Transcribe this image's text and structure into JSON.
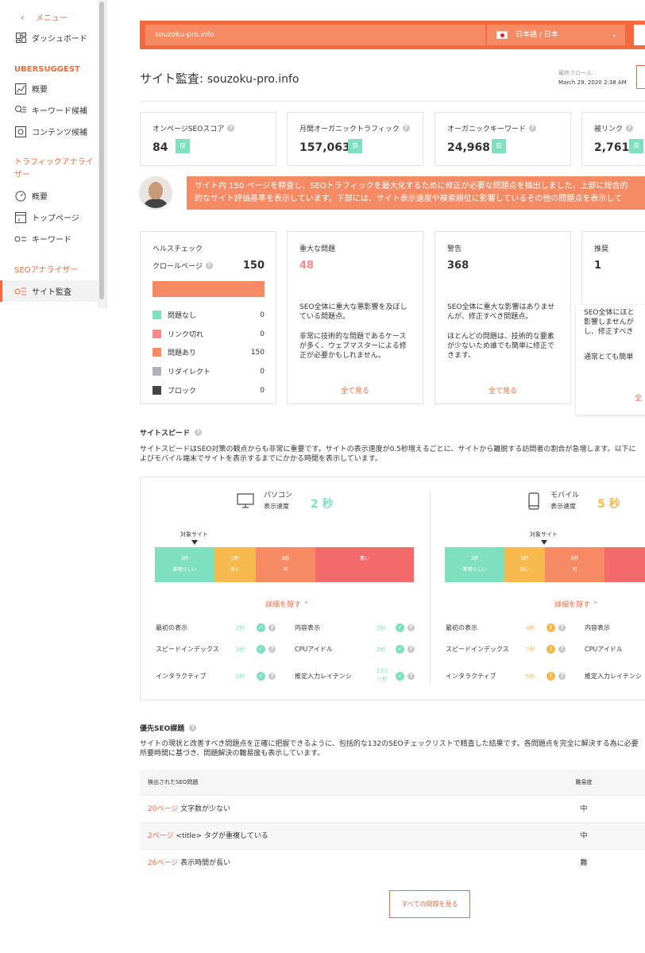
{
  "sidebar": {
    "back_label": "メニュー",
    "dashboard": "ダッシュボード",
    "section_ubersuggest": "UBERSUGGEST",
    "overview": "概要",
    "keyword_ideas": "キーワード候補",
    "content_ideas": "コンテンツ候補",
    "section_traffic": "トラフィックアナライザー",
    "traffic_overview": "概要",
    "top_pages": "トップページ",
    "keywords": "キーワード",
    "section_seo": "SEOアナライザー",
    "site_audit": "サイト監査"
  },
  "header": {
    "domain_value": "souzoku-pro.info",
    "language": "日本語 / 日本"
  },
  "page": {
    "title_prefix": "サイト監査:",
    "title_domain": "souzoku-pro.info",
    "last_crawl_label": "最終クロール:",
    "last_crawl_date": "March 29, 2020 2:38 AM"
  },
  "metrics": [
    {
      "label": "オンページSEOスコア",
      "value": "84",
      "badge": "良"
    },
    {
      "label": "月間オーガニックトラフィック",
      "value": "157,063",
      "badge": "良"
    },
    {
      "label": "オーガニックキーワード",
      "value": "24,968",
      "badge": "良"
    },
    {
      "label": "被リンク",
      "value": "2,761",
      "badge": "良"
    }
  ],
  "banner": {
    "line1": "サイト内 150 ページを精査し、SEOトラフィックを最大化するために修正が必要な問題点を抽出しました。上部に総合的",
    "line2": "的なサイト評価基準を表示しています。下部には、サイト表示速度や検索順位に影響しているその他の問題点を表示して"
  },
  "health": {
    "title": "ヘルスチェック",
    "crawl_label": "クロールページ",
    "crawl_value": "150",
    "legend": [
      {
        "label": "問題なし",
        "value": "0",
        "color": "#7ee0bf"
      },
      {
        "label": "リンク切れ",
        "value": "0",
        "color": "#f8888a"
      },
      {
        "label": "問題あり",
        "value": "150",
        "color": "#f58a64"
      },
      {
        "label": "リダイレクト",
        "value": "0",
        "color": "#b0b0b8"
      },
      {
        "label": "ブロック",
        "value": "0",
        "color": "#444444"
      }
    ]
  },
  "issues": [
    {
      "title": "重大な問題",
      "value": "48",
      "color": "#f8888a",
      "desc1": "SEO全体に重大な悪影響を及ぼし\nている問題点。",
      "desc2": "非常に技術的な問題であるケース\nが多く、ウェブマスターによる修\n正が必要かもしれません。",
      "see_all": "全て見る"
    },
    {
      "title": "警告",
      "value": "368",
      "color": "#333333",
      "desc1": "SEO全体に重大な影響はありませ\nんが、修正すべき問題点。",
      "desc2": "ほとんどの問題は、技術的な要素\nが少ないため誰でも簡単に修正で\nきます。",
      "see_all": "全て見る"
    },
    {
      "title": "推奨",
      "value": "1",
      "color": "#333333",
      "desc1": "SEO全体にほと\n影響しませんが\nし、修正すべき",
      "desc2": "通常とても簡単",
      "see_all": "全"
    }
  ],
  "speed": {
    "title": "サイトスピード",
    "desc1": "サイトスピードはSEO対策の観点からも非常に重要です。サイトの表示速度が0.5秒増えるごとに、サイトから離脱する訪問者の割合が急増します。以下に",
    "desc2": "よびモバイル端末でサイトを表示するまでにかかる時間を表示しています。",
    "target_label": "対象サイト",
    "hide_details": "詳細を隠す",
    "desktop": {
      "name": "パソコン",
      "sub": "表示速度",
      "value": "2 秒",
      "segments": [
        {
          "l1": "3秒",
          "l2": "素晴らしい",
          "color": "#7ee0bf"
        },
        {
          "l1": "5秒",
          "l2": "良い",
          "color": "#f5b94d"
        },
        {
          "l1": "8秒",
          "l2": "可",
          "color": "#f58a64"
        },
        {
          "l1": "",
          "l2": "悪い",
          "color": "#f46a6a"
        }
      ],
      "metrics": [
        {
          "label": "最初の表示",
          "value": "2秒"
        },
        {
          "label": "内容表示",
          "value": "2秒"
        },
        {
          "label": "スピードインデックス",
          "value": "3秒"
        },
        {
          "label": "CPUアイドル",
          "value": "2秒"
        },
        {
          "label": "インタラクティブ",
          "value": "2秒"
        },
        {
          "label": "推定入力レイテンシ",
          "value": "13ミリ秒"
        }
      ]
    },
    "mobile": {
      "name": "モバイル",
      "sub": "表示速度",
      "value": "5 秒",
      "segments": [
        {
          "l1": "3秒",
          "l2": "素晴らしい",
          "color": "#7ee0bf"
        },
        {
          "l1": "5秒",
          "l2": "良い",
          "color": "#f5b94d"
        },
        {
          "l1": "8秒",
          "l2": "可",
          "color": "#f58a64"
        },
        {
          "l1": "",
          "l2": "",
          "color": "#f46a6a"
        }
      ],
      "metrics": [
        {
          "label": "最初の表示",
          "value": "4秒"
        },
        {
          "label": "内容表示",
          "value": ""
        },
        {
          "label": "スピードインデックス",
          "value": "7秒"
        },
        {
          "label": "CPUアイドル",
          "value": ""
        },
        {
          "label": "インタラクティブ",
          "value": "5秒"
        },
        {
          "label": "推定入力レイテンシ",
          "value": ""
        }
      ]
    },
    "colors": {
      "good": "#7ee0bf",
      "warn": "#f5b94d"
    }
  },
  "priority": {
    "title": "優先SEO課題",
    "desc1": "サイトの現状と改善すべき問題点を正確に把握できるように、包括的な132のSEOチェックリストで精査した結果です。各問題点を完全に解決する為に必要",
    "desc2": "所要時間に基づき、問題解決の難易度も表示しています。",
    "col_issue": "検出されたSEO問題",
    "col_difficulty": "難易度",
    "rows": [
      {
        "pages": "20ページ",
        "text": "文字数が少ない",
        "difficulty": "中"
      },
      {
        "pages": "2ページ",
        "text": "<title> タグが重複している",
        "difficulty": "中"
      },
      {
        "pages": "26ページ",
        "text": "表示時間が長い",
        "difficulty": "難"
      }
    ],
    "see_all_button": "すべての問題を見る"
  }
}
